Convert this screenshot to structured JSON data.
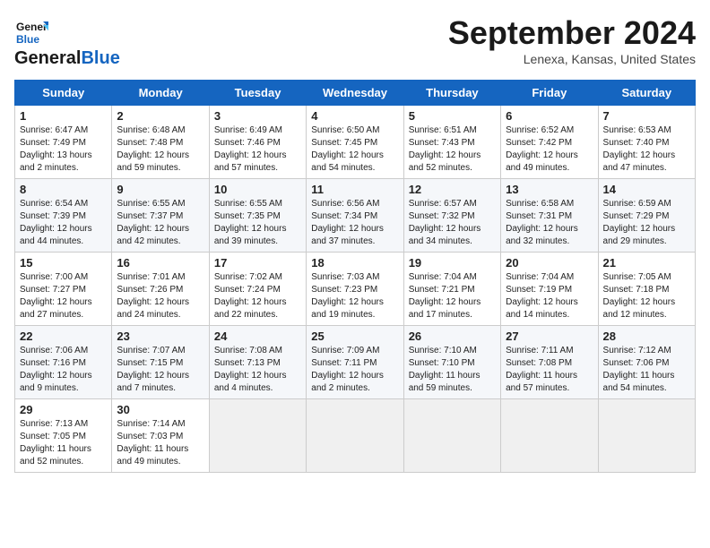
{
  "header": {
    "logo_general": "General",
    "logo_blue": "Blue",
    "month": "September 2024",
    "location": "Lenexa, Kansas, United States"
  },
  "days_of_week": [
    "Sunday",
    "Monday",
    "Tuesday",
    "Wednesday",
    "Thursday",
    "Friday",
    "Saturday"
  ],
  "weeks": [
    [
      {
        "day": "1",
        "lines": [
          "Sunrise: 6:47 AM",
          "Sunset: 7:49 PM",
          "Daylight: 13 hours",
          "and 2 minutes."
        ]
      },
      {
        "day": "2",
        "lines": [
          "Sunrise: 6:48 AM",
          "Sunset: 7:48 PM",
          "Daylight: 12 hours",
          "and 59 minutes."
        ]
      },
      {
        "day": "3",
        "lines": [
          "Sunrise: 6:49 AM",
          "Sunset: 7:46 PM",
          "Daylight: 12 hours",
          "and 57 minutes."
        ]
      },
      {
        "day": "4",
        "lines": [
          "Sunrise: 6:50 AM",
          "Sunset: 7:45 PM",
          "Daylight: 12 hours",
          "and 54 minutes."
        ]
      },
      {
        "day": "5",
        "lines": [
          "Sunrise: 6:51 AM",
          "Sunset: 7:43 PM",
          "Daylight: 12 hours",
          "and 52 minutes."
        ]
      },
      {
        "day": "6",
        "lines": [
          "Sunrise: 6:52 AM",
          "Sunset: 7:42 PM",
          "Daylight: 12 hours",
          "and 49 minutes."
        ]
      },
      {
        "day": "7",
        "lines": [
          "Sunrise: 6:53 AM",
          "Sunset: 7:40 PM",
          "Daylight: 12 hours",
          "and 47 minutes."
        ]
      }
    ],
    [
      {
        "day": "8",
        "lines": [
          "Sunrise: 6:54 AM",
          "Sunset: 7:39 PM",
          "Daylight: 12 hours",
          "and 44 minutes."
        ]
      },
      {
        "day": "9",
        "lines": [
          "Sunrise: 6:55 AM",
          "Sunset: 7:37 PM",
          "Daylight: 12 hours",
          "and 42 minutes."
        ]
      },
      {
        "day": "10",
        "lines": [
          "Sunrise: 6:55 AM",
          "Sunset: 7:35 PM",
          "Daylight: 12 hours",
          "and 39 minutes."
        ]
      },
      {
        "day": "11",
        "lines": [
          "Sunrise: 6:56 AM",
          "Sunset: 7:34 PM",
          "Daylight: 12 hours",
          "and 37 minutes."
        ]
      },
      {
        "day": "12",
        "lines": [
          "Sunrise: 6:57 AM",
          "Sunset: 7:32 PM",
          "Daylight: 12 hours",
          "and 34 minutes."
        ]
      },
      {
        "day": "13",
        "lines": [
          "Sunrise: 6:58 AM",
          "Sunset: 7:31 PM",
          "Daylight: 12 hours",
          "and 32 minutes."
        ]
      },
      {
        "day": "14",
        "lines": [
          "Sunrise: 6:59 AM",
          "Sunset: 7:29 PM",
          "Daylight: 12 hours",
          "and 29 minutes."
        ]
      }
    ],
    [
      {
        "day": "15",
        "lines": [
          "Sunrise: 7:00 AM",
          "Sunset: 7:27 PM",
          "Daylight: 12 hours",
          "and 27 minutes."
        ]
      },
      {
        "day": "16",
        "lines": [
          "Sunrise: 7:01 AM",
          "Sunset: 7:26 PM",
          "Daylight: 12 hours",
          "and 24 minutes."
        ]
      },
      {
        "day": "17",
        "lines": [
          "Sunrise: 7:02 AM",
          "Sunset: 7:24 PM",
          "Daylight: 12 hours",
          "and 22 minutes."
        ]
      },
      {
        "day": "18",
        "lines": [
          "Sunrise: 7:03 AM",
          "Sunset: 7:23 PM",
          "Daylight: 12 hours",
          "and 19 minutes."
        ]
      },
      {
        "day": "19",
        "lines": [
          "Sunrise: 7:04 AM",
          "Sunset: 7:21 PM",
          "Daylight: 12 hours",
          "and 17 minutes."
        ]
      },
      {
        "day": "20",
        "lines": [
          "Sunrise: 7:04 AM",
          "Sunset: 7:19 PM",
          "Daylight: 12 hours",
          "and 14 minutes."
        ]
      },
      {
        "day": "21",
        "lines": [
          "Sunrise: 7:05 AM",
          "Sunset: 7:18 PM",
          "Daylight: 12 hours",
          "and 12 minutes."
        ]
      }
    ],
    [
      {
        "day": "22",
        "lines": [
          "Sunrise: 7:06 AM",
          "Sunset: 7:16 PM",
          "Daylight: 12 hours",
          "and 9 minutes."
        ]
      },
      {
        "day": "23",
        "lines": [
          "Sunrise: 7:07 AM",
          "Sunset: 7:15 PM",
          "Daylight: 12 hours",
          "and 7 minutes."
        ]
      },
      {
        "day": "24",
        "lines": [
          "Sunrise: 7:08 AM",
          "Sunset: 7:13 PM",
          "Daylight: 12 hours",
          "and 4 minutes."
        ]
      },
      {
        "day": "25",
        "lines": [
          "Sunrise: 7:09 AM",
          "Sunset: 7:11 PM",
          "Daylight: 12 hours",
          "and 2 minutes."
        ]
      },
      {
        "day": "26",
        "lines": [
          "Sunrise: 7:10 AM",
          "Sunset: 7:10 PM",
          "Daylight: 11 hours",
          "and 59 minutes."
        ]
      },
      {
        "day": "27",
        "lines": [
          "Sunrise: 7:11 AM",
          "Sunset: 7:08 PM",
          "Daylight: 11 hours",
          "and 57 minutes."
        ]
      },
      {
        "day": "28",
        "lines": [
          "Sunrise: 7:12 AM",
          "Sunset: 7:06 PM",
          "Daylight: 11 hours",
          "and 54 minutes."
        ]
      }
    ],
    [
      {
        "day": "29",
        "lines": [
          "Sunrise: 7:13 AM",
          "Sunset: 7:05 PM",
          "Daylight: 11 hours",
          "and 52 minutes."
        ]
      },
      {
        "day": "30",
        "lines": [
          "Sunrise: 7:14 AM",
          "Sunset: 7:03 PM",
          "Daylight: 11 hours",
          "and 49 minutes."
        ]
      },
      {
        "day": "",
        "lines": []
      },
      {
        "day": "",
        "lines": []
      },
      {
        "day": "",
        "lines": []
      },
      {
        "day": "",
        "lines": []
      },
      {
        "day": "",
        "lines": []
      }
    ]
  ]
}
